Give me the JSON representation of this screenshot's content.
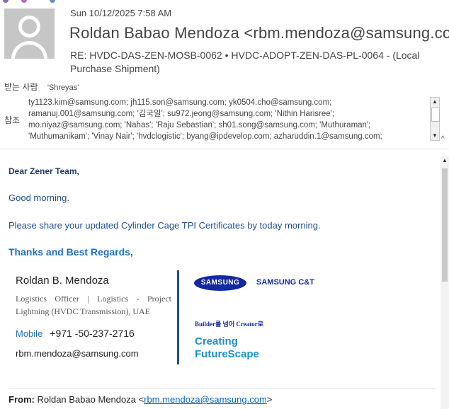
{
  "header": {
    "date": "Sun 10/12/2025 7:58 AM",
    "sender": "Roldan Babao Mendoza <rbm.mendoza@samsung.co",
    "subject": "RE: HVDC-DAS-ZEN-MOSB-0062  •  HVDC-ADOPT-ZEN-DAS-PL-0064 - (Local Purchase Shipment)"
  },
  "to": {
    "label": "받는 사람",
    "value": "'Shreyas'"
  },
  "cc": {
    "label": "참조",
    "lines": [
      "ty1123.kim@samsung.com; jh115.son@samsung.com; yk0504.cho@samsung.com;",
      "ramanuj.001@samsung.com; '김국일'; su972.jeong@samsung.com; 'Nithin Harisree';",
      "mo.niyaz@samsung.com; 'Nahas'; 'Raju Sebastian'; sh01.song@samsung.com; 'Muthuraman';",
      "'Muthumanikam'; 'Vinay Nair'; 'hvdclogistic'; byang@ipdevelop.com; azharuddin.1@samsung.com;"
    ]
  },
  "body": {
    "greeting": "Dear Zener Team,",
    "good_morning": "Good morning.",
    "request": "Please share your updated Cylinder Cage TPI Certificates by today morning.",
    "thanks": "Thanks and Best Regards,"
  },
  "signature": {
    "name": "Roldan B. Mendoza",
    "title": "Logistics Officer | Logistics - Project Lightning (HVDC Transmission), UAE",
    "mobile_label": "Mobile",
    "mobile": "+971 -50-237-2716",
    "email": "rbm.mendoza@samsung.com",
    "logo_text": "SAMSUNG",
    "company": "SAMSUNG C&T",
    "builder": "Builder를 넘어 Creator로",
    "creating": "Creating",
    "futurescape": "FutureScape"
  },
  "quoted": {
    "from_label": "From:",
    "from_name": "Roldan Babao Mendoza <",
    "from_email": "rbm.mendoza@samsung.com",
    "from_close": ">"
  },
  "colors": {
    "accent": "#1f4e8c",
    "brand": "#1428a0",
    "link": "#0563c1"
  }
}
